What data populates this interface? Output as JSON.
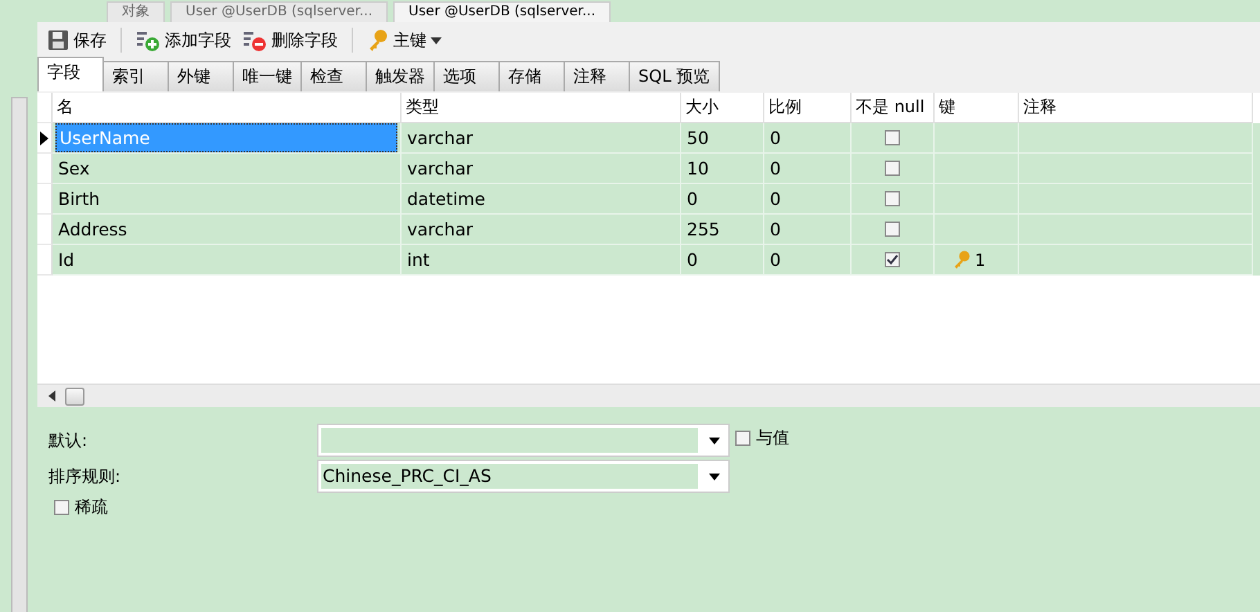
{
  "doc_tabs": [
    {
      "label": "对象",
      "selected": false
    },
    {
      "label": "User @UserDB (sqlserver...",
      "selected": false
    },
    {
      "label": "User @UserDB (sqlserver...",
      "selected": true
    }
  ],
  "toolbar": [
    {
      "kind": "save",
      "label": "保存"
    },
    {
      "kind": "add",
      "label": "添加字段"
    },
    {
      "kind": "delete",
      "label": "删除字段"
    },
    {
      "kind": "key",
      "label": "主键"
    }
  ],
  "tabs": [
    {
      "label": "字段",
      "selected": true
    },
    {
      "label": "索引",
      "selected": false
    },
    {
      "label": "外键",
      "selected": false
    },
    {
      "label": "唯一键",
      "selected": false
    },
    {
      "label": "检查",
      "selected": false
    },
    {
      "label": "触发器",
      "selected": false
    },
    {
      "label": "选项",
      "selected": false
    },
    {
      "label": "存储",
      "selected": false
    },
    {
      "label": "注释",
      "selected": false
    },
    {
      "label": "SQL 预览",
      "selected": false
    }
  ],
  "table": {
    "columns": [
      "名",
      "类型",
      "大小",
      "比例",
      "不是 null",
      "键",
      "注释"
    ],
    "rows": [
      {
        "name": "UserName",
        "type": "varchar",
        "size": "50",
        "scale": "0",
        "not_null": false,
        "selected": true
      },
      {
        "name": "Sex",
        "type": "varchar",
        "size": "10",
        "scale": "0",
        "not_null": false,
        "selected": false
      },
      {
        "name": "Birth",
        "type": "datetime",
        "size": "0",
        "scale": "0",
        "not_null": false,
        "selected": false
      },
      {
        "name": "Address",
        "type": "varchar",
        "size": "255",
        "scale": "0",
        "not_null": false,
        "selected": false
      },
      {
        "name": "Id",
        "type": "int",
        "size": "0",
        "scale": "0",
        "not_null": true,
        "key": "1",
        "selected": false
      }
    ]
  },
  "properties": {
    "default_label": "默认:",
    "with_value": {
      "label": "与值",
      "checked": false
    },
    "collation_label": "排序规则:",
    "collation_value": "Chinese_PRC_CI_AS",
    "sparse": {
      "label": "稀疏",
      "checked": false
    }
  }
}
